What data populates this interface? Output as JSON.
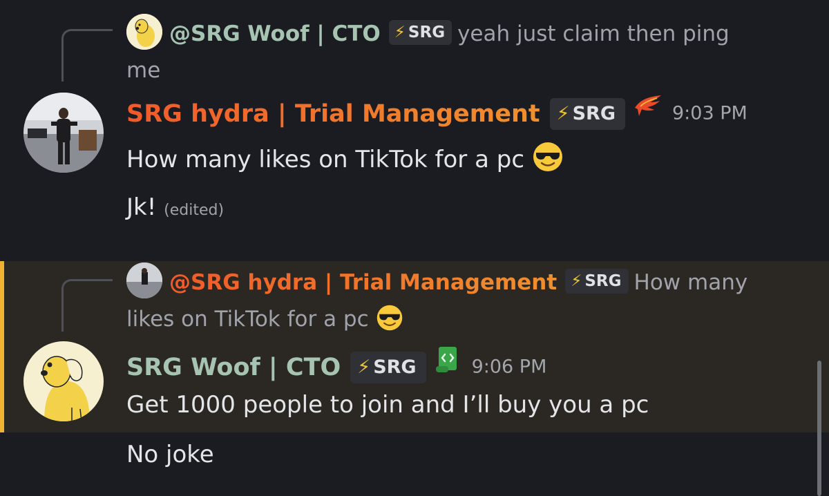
{
  "messages": [
    {
      "reply": {
        "mention": "@SRG Woof | CTO",
        "tag": "SRG",
        "text_line1": "yeah just claim then ping",
        "text_line2": "me",
        "mention_color": "#a7c4b3"
      },
      "author": {
        "name": "SRG hydra | Trial Management",
        "tag": "SRG",
        "role_icon": "phoenix-icon",
        "time": "9:03 PM"
      },
      "lines": [
        {
          "text": "How many likes on TikTok for a pc",
          "emoji": "sunglasses-emoji"
        },
        {
          "text": "Jk!",
          "edited": "(edited)"
        }
      ]
    },
    {
      "reply": {
        "mention": "@SRG hydra | Trial Management",
        "tag": "SRG",
        "text_line1": "How many",
        "text_line2": "likes on TikTok for a pc",
        "emoji": "sunglasses-emoji"
      },
      "author": {
        "name": "SRG Woof | CTO",
        "tag": "SRG",
        "role_icon": "script-scroll-icon",
        "time": "9:06 PM"
      },
      "lines": [
        {
          "text": "Get 1000 people to join and I’ll buy you a pc"
        },
        {
          "text": "No joke"
        }
      ],
      "highlighted": true
    }
  ],
  "colors": {
    "background": "#1b1c21",
    "highlight_bg": "#2b2823",
    "highlight_bar": "#f0b232",
    "woof_name": "#a7c4b3",
    "hydra_gradient_start": "#f15a2a",
    "hydra_gradient_end": "#ef8a2e"
  }
}
